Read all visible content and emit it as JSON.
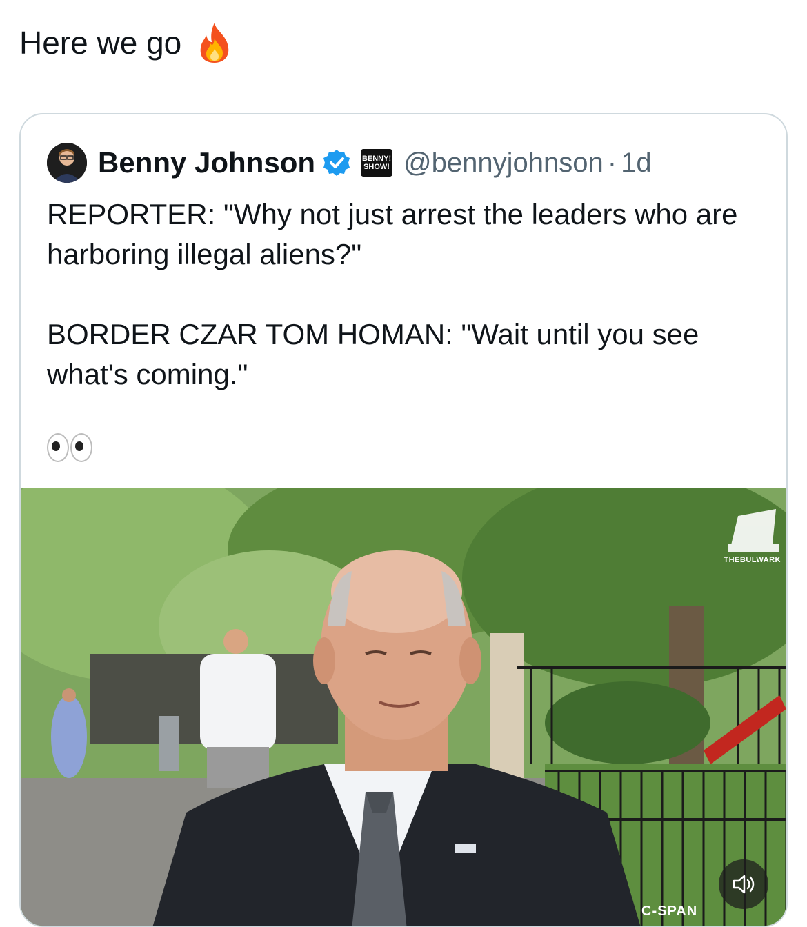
{
  "post": {
    "text": "Here we go",
    "emoji_icon": "fire-icon"
  },
  "quoted_tweet": {
    "author_name": "Benny Johnson",
    "verified_icon": "verified-badge-icon",
    "affiliation_badge": "BENNY! SHOW!",
    "handle": "@bennyjohnson",
    "separator": "·",
    "timestamp": "1d",
    "body": "REPORTER: \"Why not just arrest the leaders who are harboring illegal aliens?\"\n\nBORDER CZAR TOM HOMAN: \"Wait until you see what's coming.\"",
    "emoji_icon": "eyes-icon"
  },
  "media": {
    "watermark": "THEBULWARK",
    "channel_bug": "C-SPAN",
    "mute_icon": "speaker-icon"
  },
  "colors": {
    "text": "#0f1419",
    "muted": "#536471",
    "border": "#cfd9de",
    "verified": "#1d9bf0"
  }
}
